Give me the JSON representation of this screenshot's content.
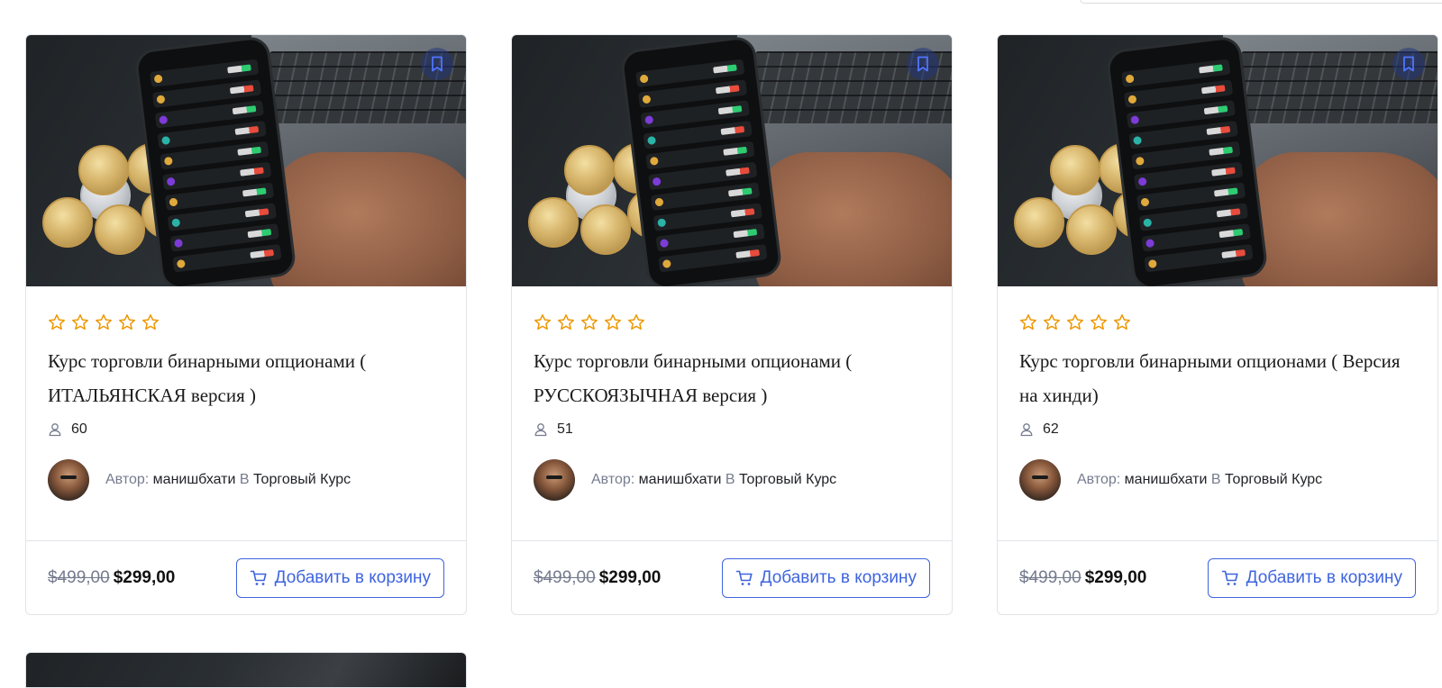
{
  "courses": [
    {
      "title": "Курс торговли бинарными опционами ( ИТАЛЬЯНСКАЯ версия )",
      "enrolled": "60",
      "author_prefix": "Автор:",
      "author_name": "манишбхати",
      "category_prefix": "В",
      "category": "Торговый Курс",
      "old_price": "$499,00",
      "price": "$299,00",
      "cart_label": "Добавить в корзину",
      "rating_stars": 0
    },
    {
      "title": "Курс торговли бинарными опционами ( РУССКОЯЗЫЧНАЯ версия )",
      "enrolled": "51",
      "author_prefix": "Автор:",
      "author_name": "манишбхати",
      "category_prefix": "В",
      "category": "Торговый Курс",
      "old_price": "$499,00",
      "price": "$299,00",
      "cart_label": "Добавить в корзину",
      "rating_stars": 0
    },
    {
      "title": "Курс торговли бинарными опционами ( Версия на хинди)",
      "enrolled": "62",
      "author_prefix": "Автор:",
      "author_name": "манишбхати",
      "category_prefix": "В",
      "category": "Торговый Курс",
      "old_price": "$499,00",
      "price": "$299,00",
      "cart_label": "Добавить в корзину",
      "rating_stars": 0
    }
  ],
  "colors": {
    "accent": "#3e64de",
    "star": "#ed9700",
    "muted_text": "#757c8e",
    "border": "#e1e4e8"
  },
  "icons": {
    "bookmark": "bookmark-icon",
    "star": "star-outline-icon",
    "user": "user-icon",
    "cart": "cart-icon"
  }
}
